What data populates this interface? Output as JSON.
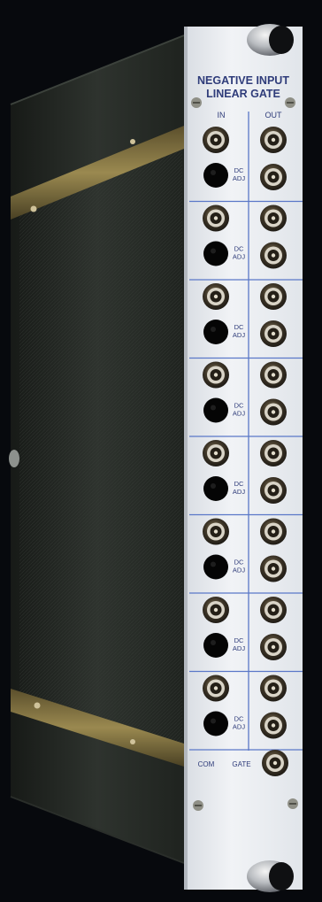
{
  "panel": {
    "title_line1": "NEGATIVE INPUT",
    "title_line2": "LINEAR GATE",
    "column_in_label": "IN",
    "column_out_label": "OUT",
    "adjust_label_line1": "DC",
    "adjust_label_line2": "ADJ",
    "gate_label_left": "COM",
    "gate_label_right": "GATE",
    "channel_count": 8
  },
  "colors": {
    "background": "#07090d",
    "panel_face": "#e9ecf0",
    "panel_text": "#2f3c7a",
    "divider_blue": "#5a77c8",
    "chassis_side": "#2a2f2a",
    "rail_brass": "#7a6a3a"
  },
  "icons": {
    "bnc_connector": "bnc-connector-icon",
    "adjust_hole": "trim-pot-hole-icon",
    "thumb_screw": "thumb-screw-icon",
    "panel_screw": "panel-screw-icon"
  }
}
